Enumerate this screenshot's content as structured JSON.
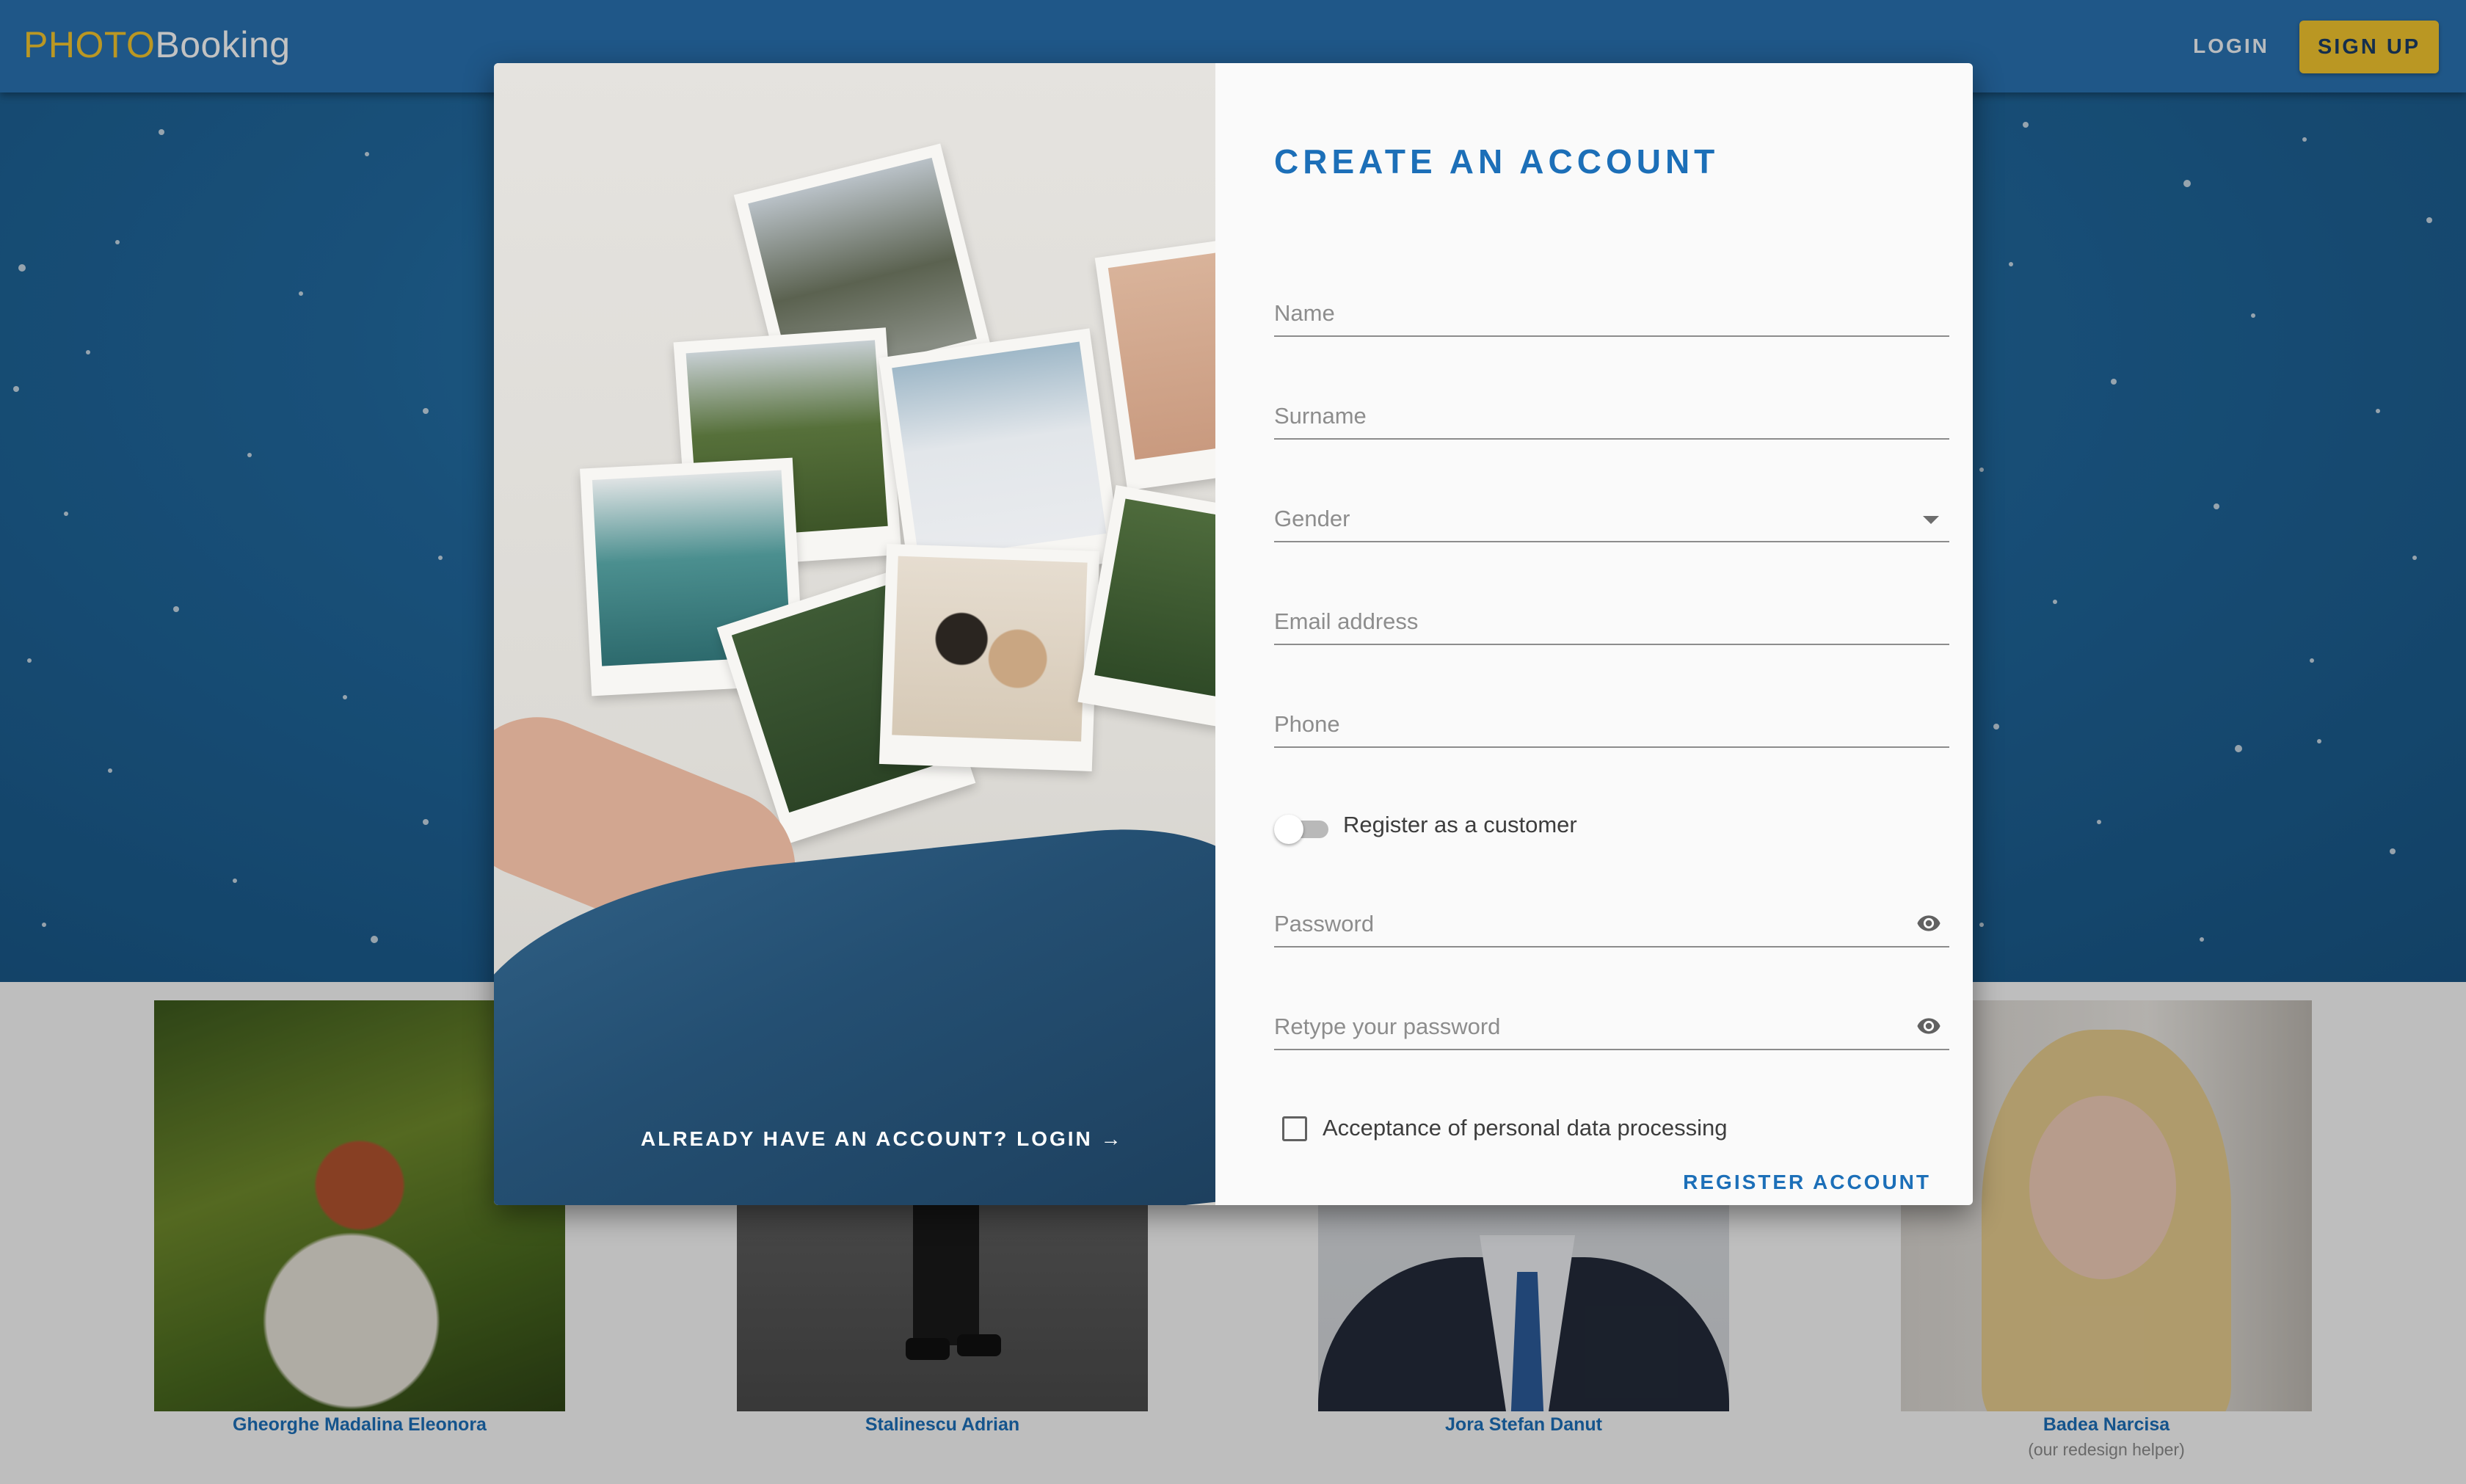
{
  "app": {
    "logo_part1": "PHOTO",
    "logo_part2": "Booking",
    "nav": {
      "login": "LOGIN",
      "signup": "SIGN UP"
    }
  },
  "team": [
    {
      "name": "Gheorghe Madalina Eleonora",
      "note": ""
    },
    {
      "name": "Stalinescu Adrian",
      "note": ""
    },
    {
      "name": "Jora Stefan Danut",
      "note": ""
    },
    {
      "name": "Badea Narcisa",
      "note": "(our redesign helper)"
    }
  ],
  "dialog": {
    "image_link": "ALREADY HAVE AN ACCOUNT? LOGIN →",
    "title": "CREATE AN ACCOUNT",
    "fields": {
      "name": {
        "placeholder": "Name",
        "value": ""
      },
      "surname": {
        "placeholder": "Surname",
        "value": ""
      },
      "gender": {
        "placeholder": "Gender",
        "value": ""
      },
      "email": {
        "placeholder": "Email address",
        "value": ""
      },
      "phone": {
        "placeholder": "Phone",
        "value": ""
      },
      "password": {
        "placeholder": "Password",
        "value": ""
      },
      "retype_password": {
        "placeholder": "Retype your password",
        "value": ""
      }
    },
    "toggle": {
      "label": "Register as a customer",
      "on": false
    },
    "consent": {
      "label": "Acceptance of personal data processing",
      "checked": false
    },
    "submit": "REGISTER ACCOUNT"
  },
  "colors": {
    "brand_yellow": "#f5c72e",
    "primary_blue": "#1c6fb8",
    "appbar_blue": "#2a73b3"
  },
  "icons": [
    "visibility-icon",
    "dropdown-arrow-icon"
  ]
}
